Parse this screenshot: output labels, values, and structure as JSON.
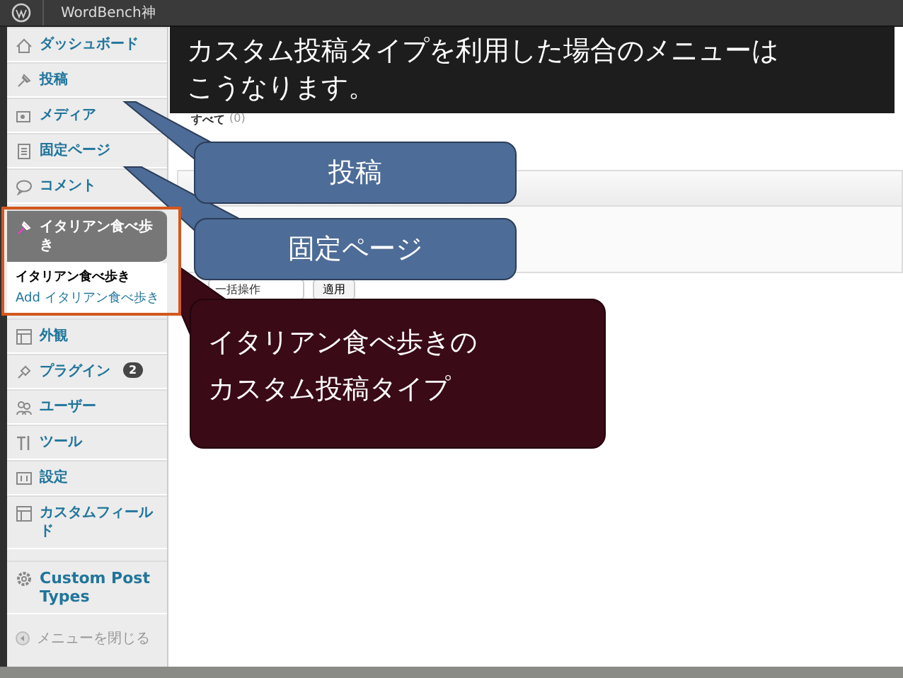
{
  "admin_bar": {
    "site": "WordBench神"
  },
  "sidebar": {
    "items": [
      {
        "label": "ダッシュボード",
        "selected": false
      },
      {
        "label": "投稿",
        "selected": false
      },
      {
        "label": "メディア",
        "selected": false
      },
      {
        "label": "固定ページ",
        "selected": false
      },
      {
        "label": "コメント",
        "selected": false
      },
      {
        "label": "イタリアン食べ歩き",
        "selected": true,
        "children": [
          {
            "label": "イタリアン食べ歩き",
            "selected": true
          },
          {
            "label": "Add イタリアン食べ歩き",
            "selected": false
          }
        ]
      },
      {
        "label": "外観",
        "selected": false
      },
      {
        "label": "プラグイン",
        "selected": false,
        "badge": "2"
      },
      {
        "label": "ユーザー",
        "selected": false
      },
      {
        "label": "ツール",
        "selected": false
      },
      {
        "label": "設定",
        "selected": false
      },
      {
        "label": "カスタムフィールド",
        "selected": false
      },
      {
        "label": "Custom Post Types",
        "selected": false
      }
    ],
    "collapse": "メニューを閉じる"
  },
  "content": {
    "filter": "すべて",
    "count": "(0)",
    "bulk_action": "一括操作",
    "apply": "適用"
  },
  "annotations": [
    {
      "kind": "caption",
      "lines": [
        "カスタム投稿タイプを利用した場合のメニューは",
        "こうなります。"
      ]
    },
    {
      "kind": "blue",
      "lines": [
        "投稿"
      ]
    },
    {
      "kind": "blue",
      "lines": [
        "固定ページ"
      ]
    },
    {
      "kind": "maroon",
      "lines": [
        "イタリアン食べ歩きの",
        "カスタム投稿タイプ"
      ]
    }
  ]
}
